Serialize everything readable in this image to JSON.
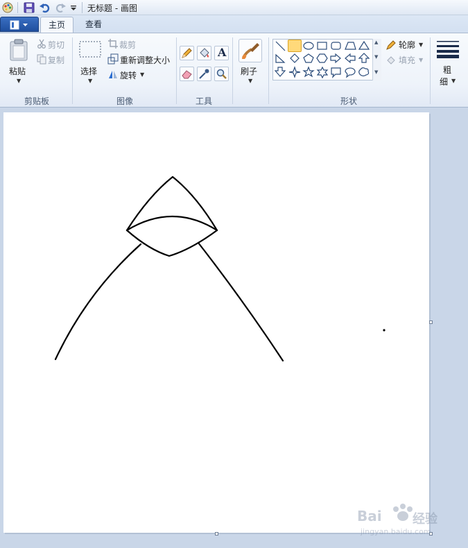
{
  "app": {
    "window_title": "无标题 - 画图"
  },
  "tabs": [
    {
      "label": "主页"
    },
    {
      "label": "查看"
    }
  ],
  "ribbon": {
    "clipboard": {
      "paste": "粘贴",
      "cut": "剪切",
      "copy": "复制",
      "group_label": "剪贴板"
    },
    "image": {
      "select": "选择",
      "crop": "裁剪",
      "resize": "重新调整大小",
      "rotate": "旋转",
      "group_label": "图像"
    },
    "tools": {
      "group_label": "工具",
      "text_tool_glyph": "A"
    },
    "brushes": {
      "label": "刷子"
    },
    "shapes": {
      "outline": "轮廓",
      "fill": "填充",
      "group_label": "形状"
    },
    "size": {
      "label_top": "粗",
      "label_bottom": "细"
    }
  },
  "colors": {
    "accent": "#1f4f9e",
    "selected_shape": "#ffd97a",
    "stroke": "#000000"
  },
  "watermark": {
    "text_top": "Bai",
    "text_brand": "经验",
    "text_url": "jingyan.baidu.com"
  }
}
